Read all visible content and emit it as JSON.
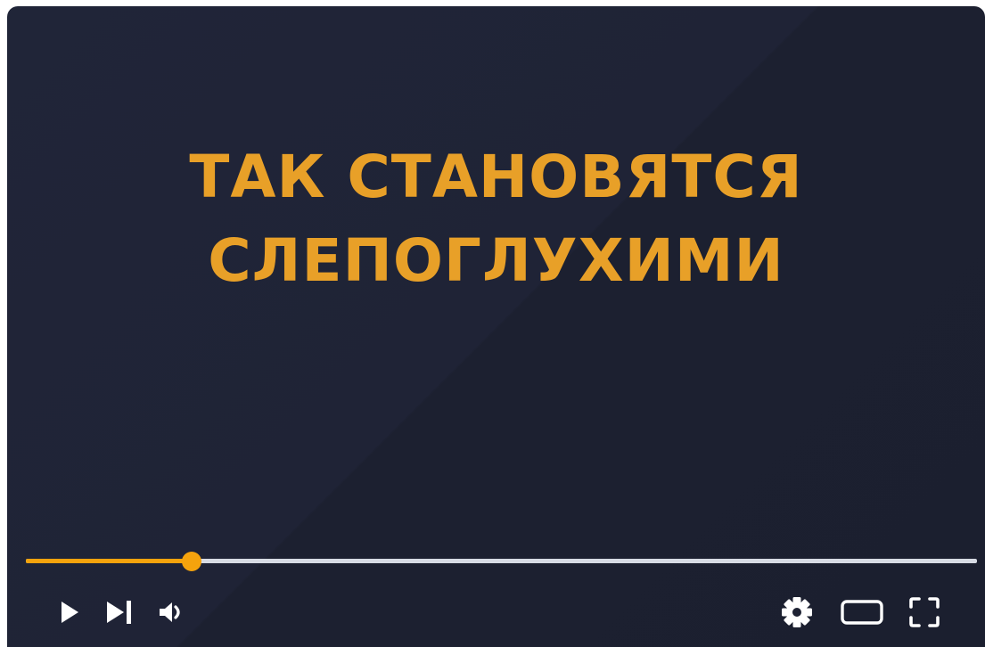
{
  "video": {
    "title_line1": "ТАК СТАНОВЯТСЯ",
    "title_line2": "СЛЕПОГЛУХИМИ"
  },
  "colors": {
    "accent": "#f5a30d",
    "title": "#e8a028",
    "background": "#1e2233",
    "track": "#d7dbe4",
    "icon": "#ffffff"
  },
  "progress": {
    "played_fraction": 0.174
  },
  "controls": {
    "left": [
      "play-icon",
      "next-icon",
      "volume-icon"
    ],
    "right": [
      "settings-icon",
      "theater-mode-icon",
      "fullscreen-icon"
    ]
  }
}
